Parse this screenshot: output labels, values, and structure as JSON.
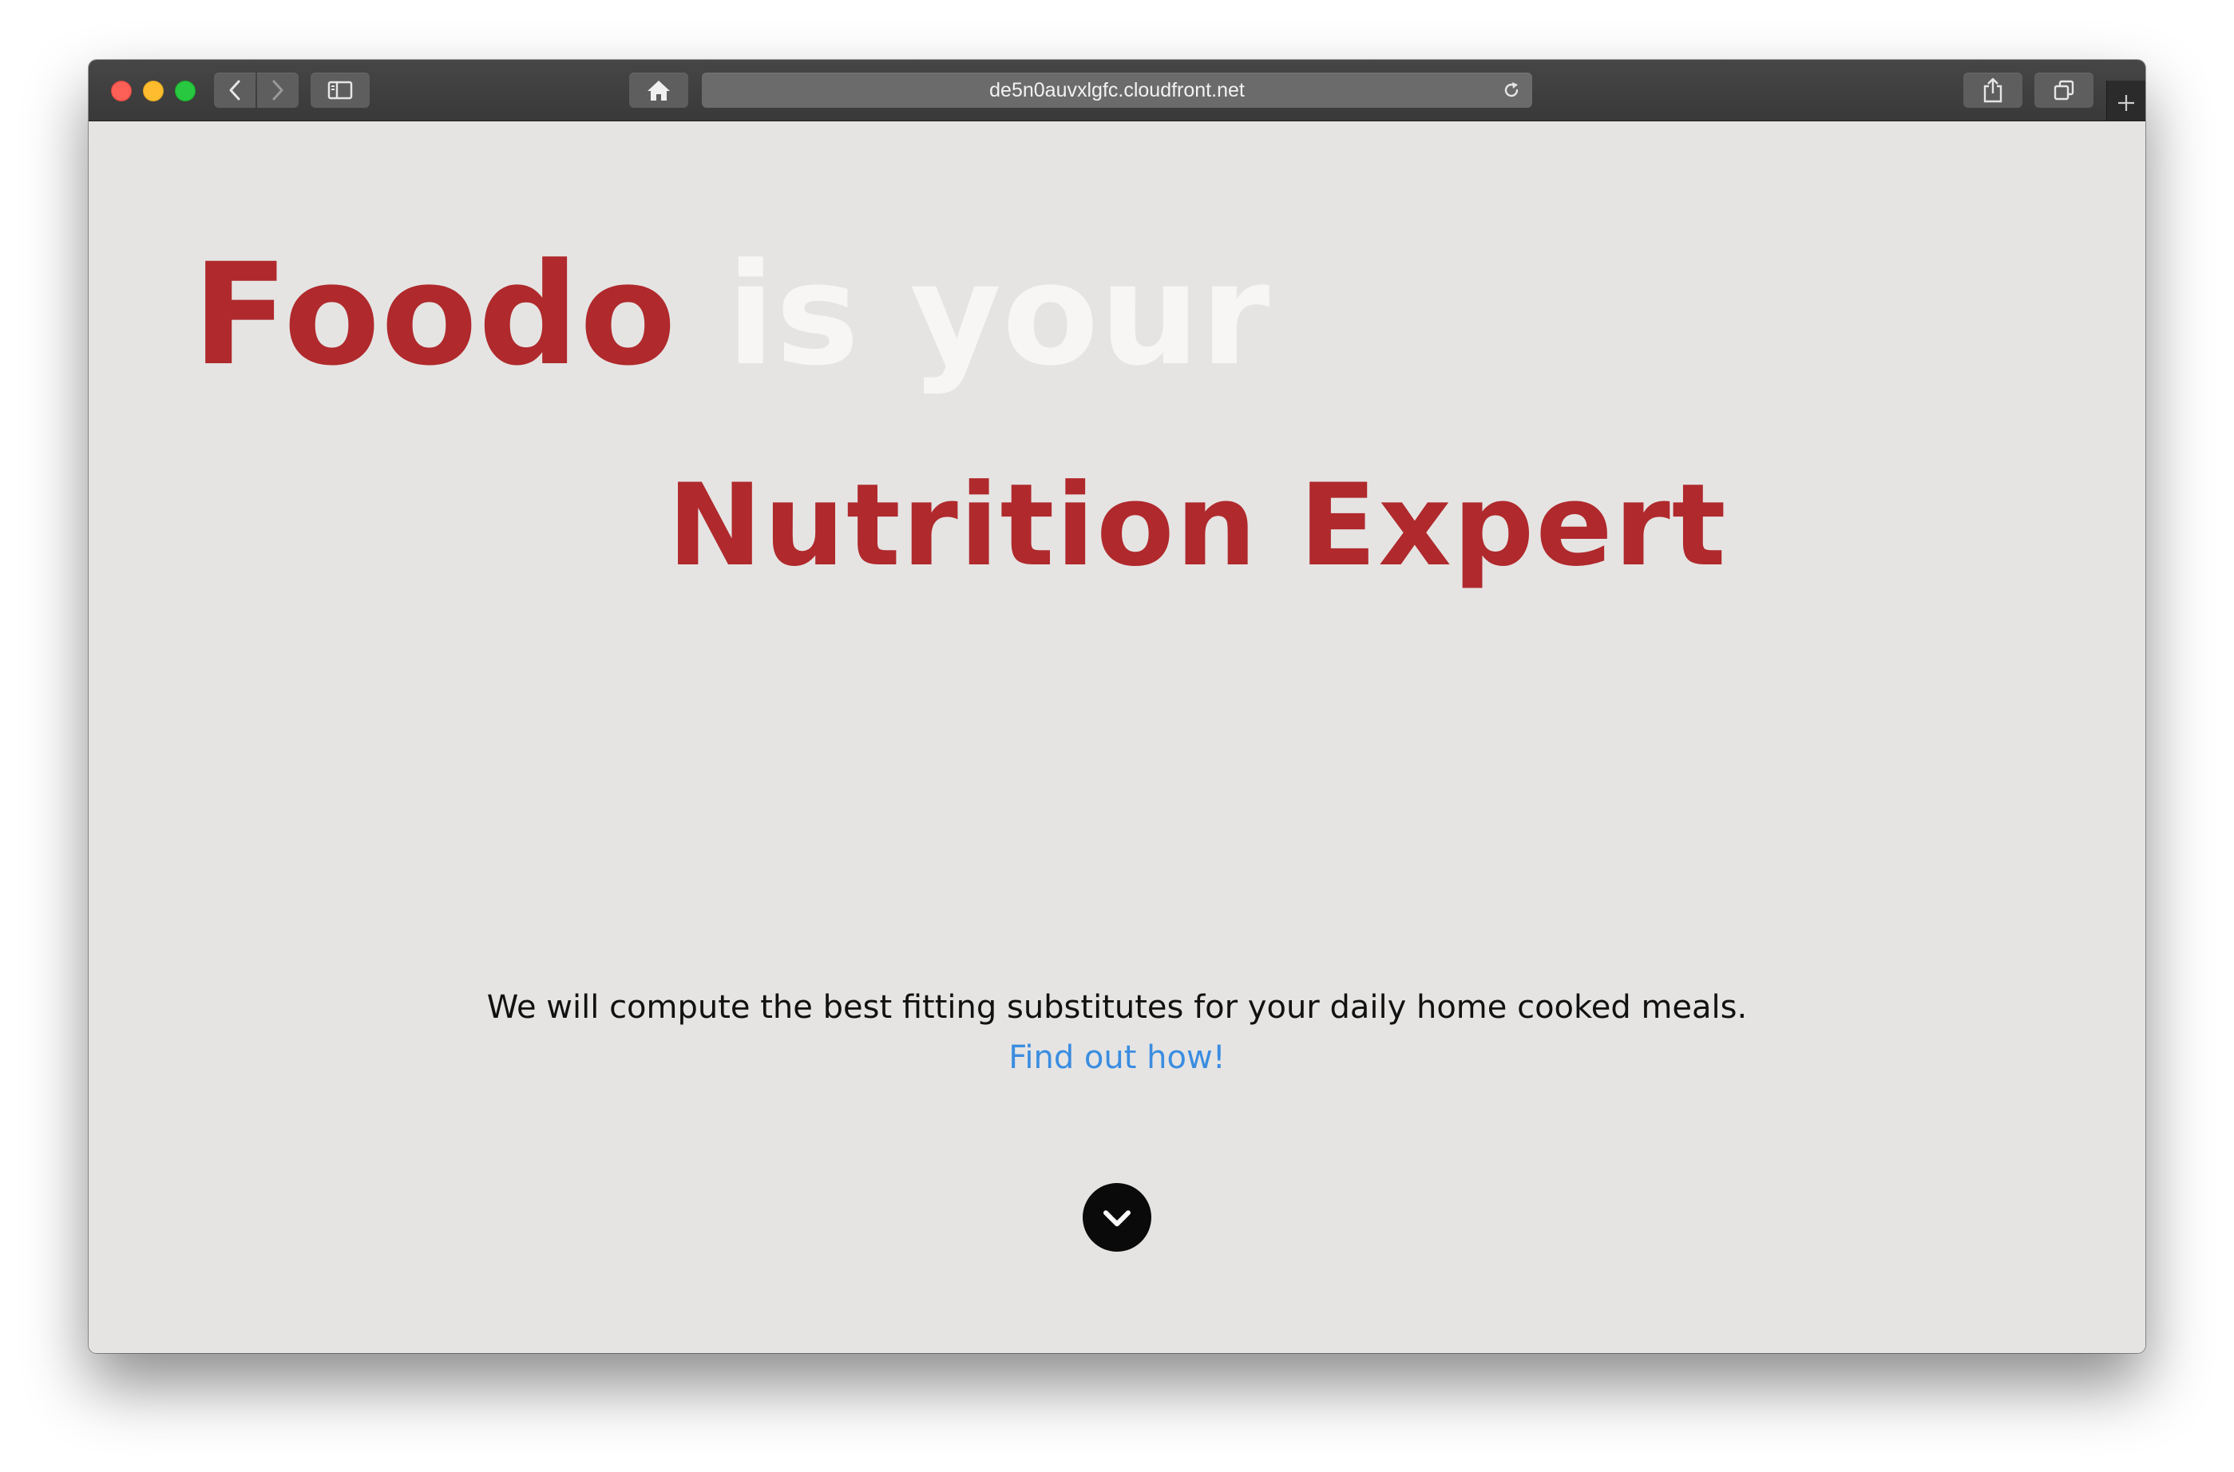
{
  "browser": {
    "url": "de5n0auvxlgfc.cloudfront.net",
    "icons": {
      "back": "chevron-left-icon",
      "forward": "chevron-right-icon",
      "sidebar": "sidebar-icon",
      "home": "home-icon",
      "reload": "reload-icon",
      "share": "share-icon",
      "tabs": "tabs-overview-icon",
      "new_tab": "plus-icon"
    }
  },
  "hero": {
    "brand": "Foodo",
    "line1_rest": " is your",
    "line2": "Nutrition Expert"
  },
  "intro": {
    "tagline": "We will compute the best fitting substitutes for your daily home cooked meals.",
    "cta": "Find out how!"
  },
  "scroll": {
    "icon": "chevron-down-icon"
  },
  "colors": {
    "brand_red": "#b0292c",
    "hero_light": "#f7f6f5",
    "link_blue": "#3b8de0",
    "page_background": "#e5e4e3",
    "toolbar": "#3e3e3e"
  }
}
